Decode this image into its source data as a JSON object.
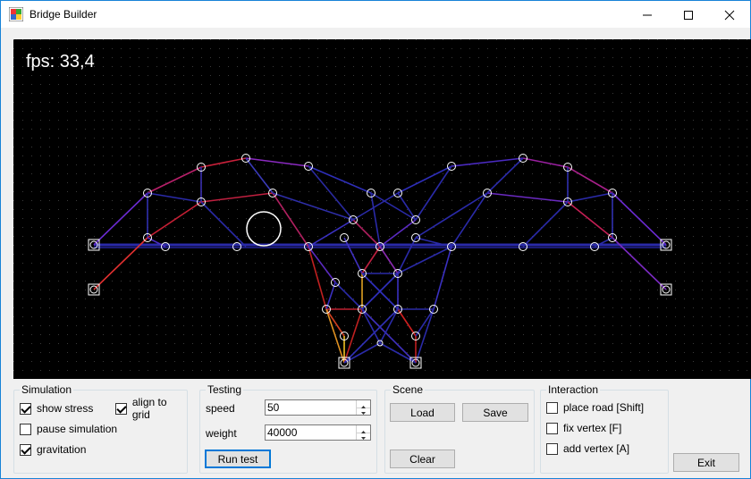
{
  "window": {
    "title": "Bridge Builder"
  },
  "canvas": {
    "fps_label": "fps: 33,4"
  },
  "simulation": {
    "title": "Simulation",
    "show_stress": "show stress",
    "align_to_grid": "align to grid",
    "pause_simulation": "pause simulation",
    "gravitation": "gravitation"
  },
  "testing": {
    "title": "Testing",
    "speed_label": "speed",
    "speed_value": "50",
    "weight_label": "weight",
    "weight_value": "40000",
    "run_test": "Run test"
  },
  "scene": {
    "title": "Scene",
    "load": "Load",
    "save": "Save",
    "clear": "Clear"
  },
  "interaction": {
    "title": "Interaction",
    "place_road": "place road [Shift]",
    "fix_vertex": "fix vertex [F]",
    "add_vertex": "add vertex [A]"
  },
  "exit": "Exit",
  "checkbox_states": {
    "show_stress": true,
    "align_to_grid": true,
    "pause_simulation": false,
    "gravitation": true,
    "place_road": false,
    "fix_vertex": false,
    "add_vertex": false
  },
  "colors": {
    "window_border": "#1883d7",
    "canvas_bg": "#000000",
    "stress_low": "#2a2aa8",
    "stress_high": "#d42020"
  }
}
